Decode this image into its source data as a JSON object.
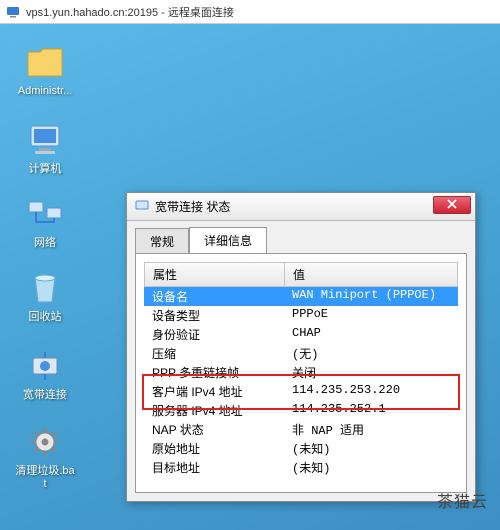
{
  "window": {
    "title": "vps1.yun.hahado.cn:20195 - 远程桌面连接"
  },
  "desktop_icons": {
    "admin": "Administr...",
    "computer": "计算机",
    "network": "网络",
    "recycle": "回收站",
    "broadband": "宽带连接",
    "cleanbat": "清理垃圾.bat"
  },
  "dialog": {
    "title": "宽带连接 状态",
    "tabs": {
      "general": "常规",
      "details": "详细信息"
    },
    "columns": {
      "prop": "属性",
      "val": "值"
    },
    "rows": [
      {
        "prop": "设备名",
        "val": "WAN Miniport (PPPOE)",
        "selected": true
      },
      {
        "prop": "设备类型",
        "val": "PPPoE"
      },
      {
        "prop": "身份验证",
        "val": "CHAP"
      },
      {
        "prop": "压缩",
        "val": "(无)"
      },
      {
        "prop": "PPP 多重链接帧",
        "val": "关闭"
      },
      {
        "prop": "客户端 IPv4 地址",
        "val": "114.235.253.220"
      },
      {
        "prop": "服务器 IPv4 地址",
        "val": "114.235.252.1"
      },
      {
        "prop": "NAP 状态",
        "val": "非 NAP 适用"
      },
      {
        "prop": "原始地址",
        "val": "(未知)"
      },
      {
        "prop": "目标地址",
        "val": "(未知)"
      }
    ]
  },
  "watermark": "茶猫云"
}
